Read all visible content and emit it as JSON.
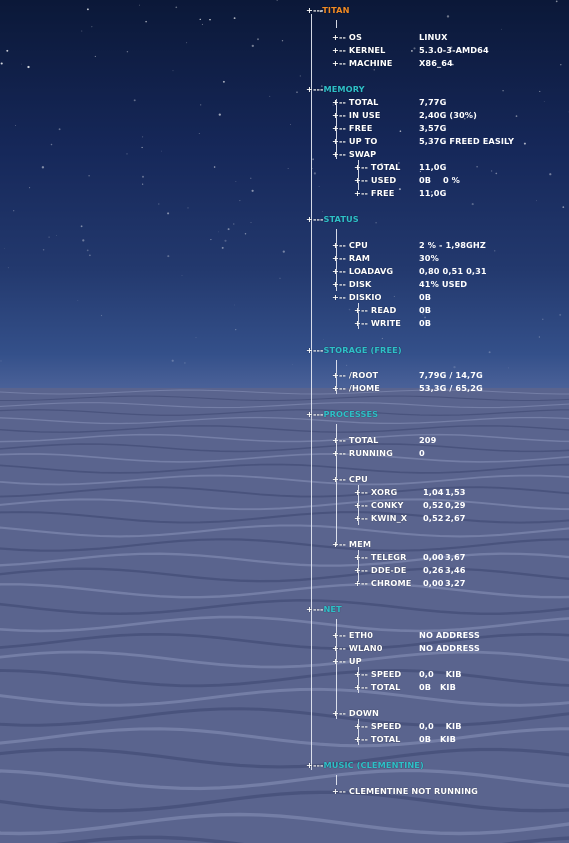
{
  "colors": {
    "titan_header": "#f08a24",
    "section_header": "#2ec0c8",
    "text": "#ffffff"
  },
  "titan": {
    "header": "TITAN",
    "rows": [
      {
        "label": "OS",
        "value": "LINUX"
      },
      {
        "label": "KERNEL",
        "value": "5.3.0-3-AMD64"
      },
      {
        "label": "MACHINE",
        "value": "X86_64"
      }
    ]
  },
  "memory": {
    "header": "MEMORY",
    "rows": [
      {
        "label": "TOTAL",
        "value": "7,77G"
      },
      {
        "label": "IN USE",
        "value": "2,40G (30%)"
      },
      {
        "label": "FREE",
        "value": "3,57G"
      },
      {
        "label": "UP TO",
        "value": "5,37G FREED EASILY"
      },
      {
        "label": "SWAP",
        "value": ""
      }
    ],
    "swap": [
      {
        "label": "TOTAL",
        "value": "11,0G"
      },
      {
        "label": "USED",
        "value": "0B    0 %"
      },
      {
        "label": "FREE",
        "value": "11,0G"
      }
    ]
  },
  "status": {
    "header": "STATUS",
    "rows": [
      {
        "label": "CPU",
        "value": "2 % - 1,98GHZ"
      },
      {
        "label": "RAM",
        "value": "30%"
      },
      {
        "label": "LOADAVG",
        "value": "0,80 0,51 0,31"
      },
      {
        "label": "DISK",
        "value": "41% USED"
      },
      {
        "label": "DISKIO",
        "value": "0B"
      }
    ],
    "diskio": [
      {
        "label": "READ",
        "value": "0B"
      },
      {
        "label": "WRITE",
        "value": "0B"
      }
    ]
  },
  "storage": {
    "header": "STORAGE (FREE)",
    "rows": [
      {
        "label": "/ROOT",
        "value": "7,79G / 14,7G"
      },
      {
        "label": "/HOME",
        "value": "53,3G / 65,2G"
      }
    ]
  },
  "processes": {
    "header": "PROCESSES",
    "rows": [
      {
        "label": "TOTAL",
        "value": "209"
      },
      {
        "label": "RUNNING",
        "value": "0"
      }
    ],
    "cpu_label": "CPU",
    "cpu": [
      {
        "label": "XORG",
        "v1": "1,04",
        "v2": "1,53"
      },
      {
        "label": "CONKY",
        "v1": "0,52",
        "v2": "0,29"
      },
      {
        "label": "KWIN_X",
        "v1": "0,52",
        "v2": "2,67"
      }
    ],
    "mem_label": "MEM",
    "mem": [
      {
        "label": "TELEGR",
        "v1": "0,00",
        "v2": "3,67"
      },
      {
        "label": "DDE-DE",
        "v1": "0,26",
        "v2": "3,46"
      },
      {
        "label": "CHROME",
        "v1": "0,00",
        "v2": "3,27"
      }
    ]
  },
  "net": {
    "header": "NET",
    "rows": [
      {
        "label": "ETH0",
        "value": "NO ADDRESS"
      },
      {
        "label": "WLAN0",
        "value": "NO ADDRESS"
      }
    ],
    "up_label": "UP",
    "up": [
      {
        "label": "SPEED",
        "value": "0,0    KIB"
      },
      {
        "label": "TOTAL",
        "value": "0B   KIB"
      }
    ],
    "down_label": "DOWN",
    "down": [
      {
        "label": "SPEED",
        "value": "0,0    KIB"
      },
      {
        "label": "TOTAL",
        "value": "0B   KIB"
      }
    ]
  },
  "music": {
    "header": "MUSIC (CLEMENTINE)",
    "status": "CLEMENTINE NOT RUNNING"
  }
}
